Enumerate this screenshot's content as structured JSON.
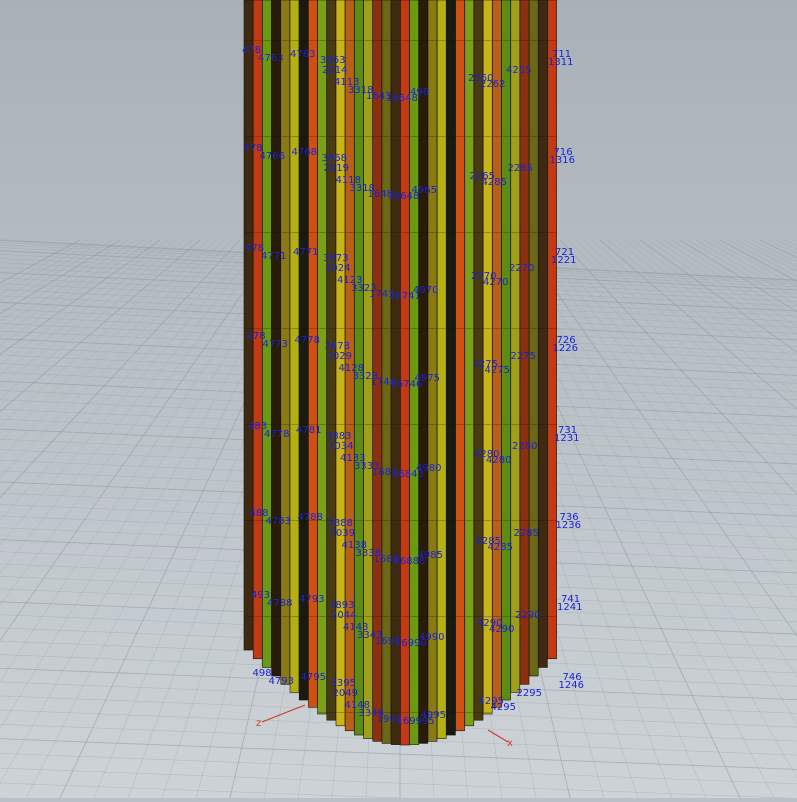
{
  "viewport": {
    "name": "3D viewport",
    "axis_labels": {
      "z": "z",
      "x": "x"
    },
    "label_rows": [
      {
        "left_a": "478",
        "left_b": "4763",
        "mid_a": "4763",
        "mid_b": "3863",
        "mid_c": "2014",
        "center_a": "4113",
        "center_b": "3318",
        "center_c": "1643",
        "center_d": "16648",
        "center_e": "496",
        "right_a": "2260",
        "right_b": "2262",
        "right_c": "4255",
        "far_a": "711",
        "far_b": "1311"
      },
      {
        "left_a": "478",
        "left_b": "4766",
        "mid_a": "4768",
        "mid_b": "3868",
        "mid_c": "2019",
        "center_a": "4118",
        "center_b": "3318",
        "center_c": "1648",
        "center_d": "16648",
        "center_e": "4965",
        "right_a": "2265",
        "right_b": "4285",
        "right_c": "2265",
        "far_a": "716",
        "far_b": "1316"
      },
      {
        "left_a": "478",
        "left_b": "4771",
        "mid_a": "4771",
        "mid_b": "3873",
        "mid_c": "2024",
        "center_a": "4123",
        "center_b": "3323",
        "center_c": "1743",
        "center_d": "16741",
        "center_e": "4970",
        "right_a": "2270",
        "right_b": "4270",
        "right_c": "2270",
        "far_a": "721",
        "far_b": "1221"
      },
      {
        "left_a": "478",
        "left_b": "4773",
        "mid_a": "4778",
        "mid_b": "3878",
        "mid_c": "2029",
        "center_a": "4128",
        "center_b": "3328",
        "center_c": "1746",
        "center_d": "16746",
        "center_e": "4975",
        "right_a": "4275",
        "right_b": "4275",
        "right_c": "2275",
        "far_a": "726",
        "far_b": "1226"
      },
      {
        "left_a": "483",
        "left_b": "4778",
        "mid_a": "4781",
        "mid_b": "3883",
        "mid_c": "2034",
        "center_a": "4133",
        "center_b": "3333",
        "center_c": "1683",
        "center_d": "16843",
        "center_e": "4980",
        "right_a": "4280",
        "right_b": "4280",
        "right_c": "2280",
        "far_a": "731",
        "far_b": "1231"
      },
      {
        "left_a": "488",
        "left_b": "4783",
        "mid_a": "4788",
        "mid_b": "3888",
        "mid_c": "2039",
        "center_a": "4138",
        "center_b": "3338",
        "center_c": "1688",
        "center_d": "16888",
        "center_e": "4985",
        "right_a": "4285",
        "right_b": "4285",
        "right_c": "2285",
        "far_a": "736",
        "far_b": "1236"
      },
      {
        "left_a": "493",
        "left_b": "4788",
        "mid_a": "4793",
        "mid_b": "3893",
        "mid_c": "2044",
        "center_a": "4143",
        "center_b": "3343",
        "center_c": "1693",
        "center_d": "16990",
        "center_e": "4990",
        "right_a": "4290",
        "right_b": "4290",
        "right_c": "2290",
        "far_a": "741",
        "far_b": "1241"
      },
      {
        "left_a": "498",
        "left_b": "4793",
        "mid_a": "4795",
        "mid_b": "3395",
        "mid_c": "2049",
        "center_a": "4148",
        "center_b": "3348",
        "center_c": "1993",
        "center_d": "169995",
        "center_e": "4995",
        "right_a": "4295",
        "right_b": "4295",
        "right_c": "2295",
        "far_a": "746",
        "far_b": "1246"
      }
    ]
  },
  "colors": {
    "background_top": "#a9b2b8",
    "background_bottom": "#cdd4d8",
    "grid_line": "#8f989e",
    "label_text": "#1a22d8",
    "axis": "#d23a2a"
  }
}
